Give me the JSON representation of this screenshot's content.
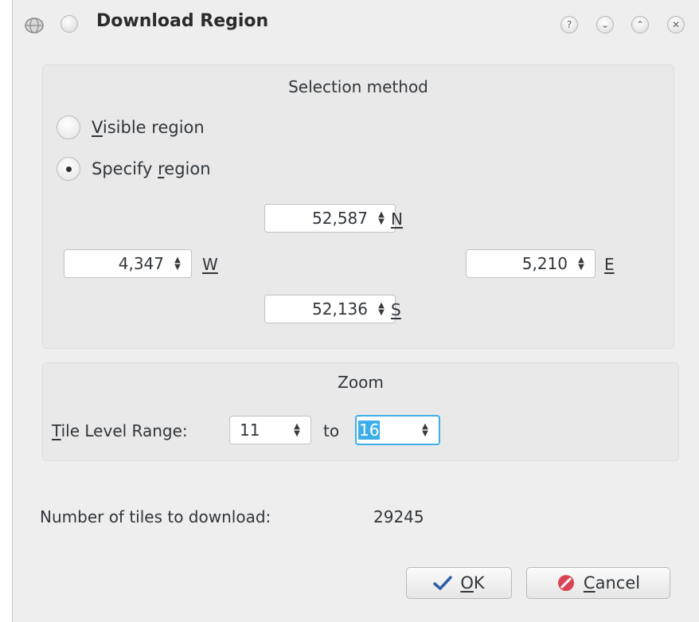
{
  "window": {
    "title": "Download Region"
  },
  "titlebar": {
    "app_icon": "globe-icon",
    "buttons": [
      "help-icon",
      "minimize-icon",
      "maximize-icon",
      "close-icon"
    ],
    "help_glyph": "?",
    "min_glyph": "⌄",
    "max_glyph": "⌃",
    "close_glyph": "✕"
  },
  "selection": {
    "title": "Selection method",
    "visible_region": {
      "label_mnemonic": "V",
      "label_rest": "isible region",
      "checked": false
    },
    "specify_region": {
      "label_pre": "Specify ",
      "label_mnemonic": "r",
      "label_rest": "egion",
      "checked": true
    },
    "north": {
      "value": "52,587",
      "label": "N"
    },
    "west": {
      "value": "4,347",
      "label": "W"
    },
    "east": {
      "value": "5,210",
      "label": "E"
    },
    "south": {
      "value": "52,136",
      "label": "S"
    }
  },
  "zoom": {
    "title": "Zoom",
    "range_label_mnemonic": "T",
    "range_label_rest": "ile Level Range:",
    "from": "11",
    "to_label": "to",
    "to": "16"
  },
  "tiles": {
    "label": "Number of tiles to download:",
    "count": "29245"
  },
  "buttons": {
    "ok_mnemonic": "O",
    "ok_rest": "K",
    "cancel_mnemonic": "C",
    "cancel_rest": "ancel"
  },
  "colors": {
    "accent": "#3daee9",
    "background": "#eeeeee",
    "cancel_icon": "#da4453"
  }
}
